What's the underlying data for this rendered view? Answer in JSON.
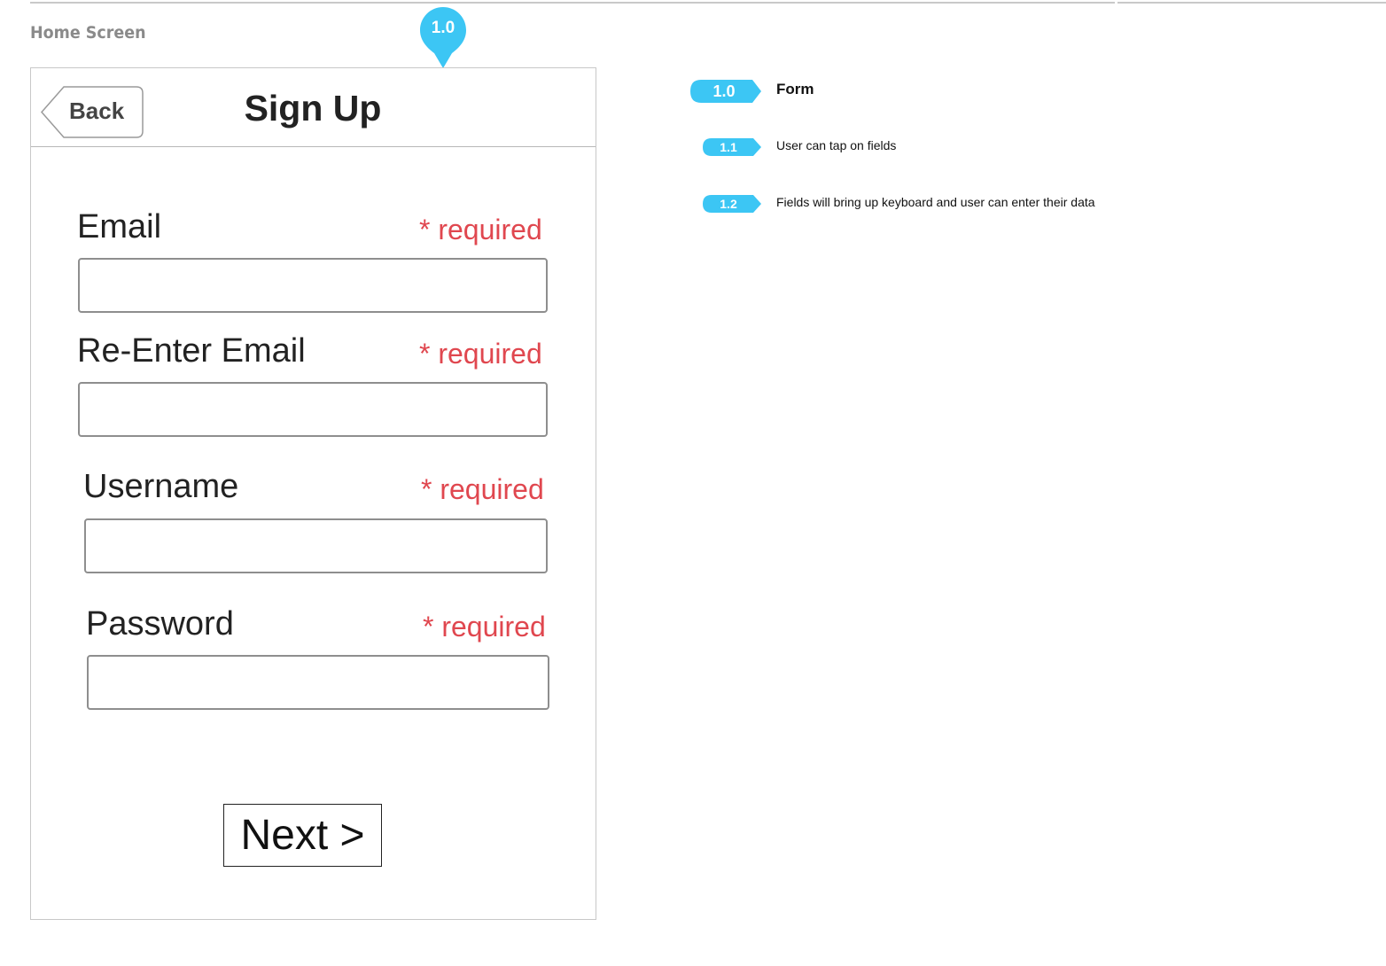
{
  "screen": {
    "title": "Home Screen"
  },
  "pin": {
    "label": "1.0",
    "color": "#3cc6f4"
  },
  "navbar": {
    "back_label": "Back",
    "title": "Sign Up"
  },
  "form": {
    "fields": [
      {
        "label": "Email",
        "required": "* required",
        "value": ""
      },
      {
        "label": "Re-Enter Email",
        "required": "* required",
        "value": ""
      },
      {
        "label": "Username",
        "required": "* required",
        "value": ""
      },
      {
        "label": "Password",
        "required": "* required",
        "value": ""
      }
    ],
    "next_label": "Next >",
    "required_color": "#e0474f"
  },
  "annotations": [
    {
      "tag": "1.0",
      "text": "Form"
    },
    {
      "tag": "1.1",
      "text": "User can tap on fields"
    },
    {
      "tag": "1.2",
      "text": "Fields will bring up keyboard and user can enter their data"
    }
  ]
}
